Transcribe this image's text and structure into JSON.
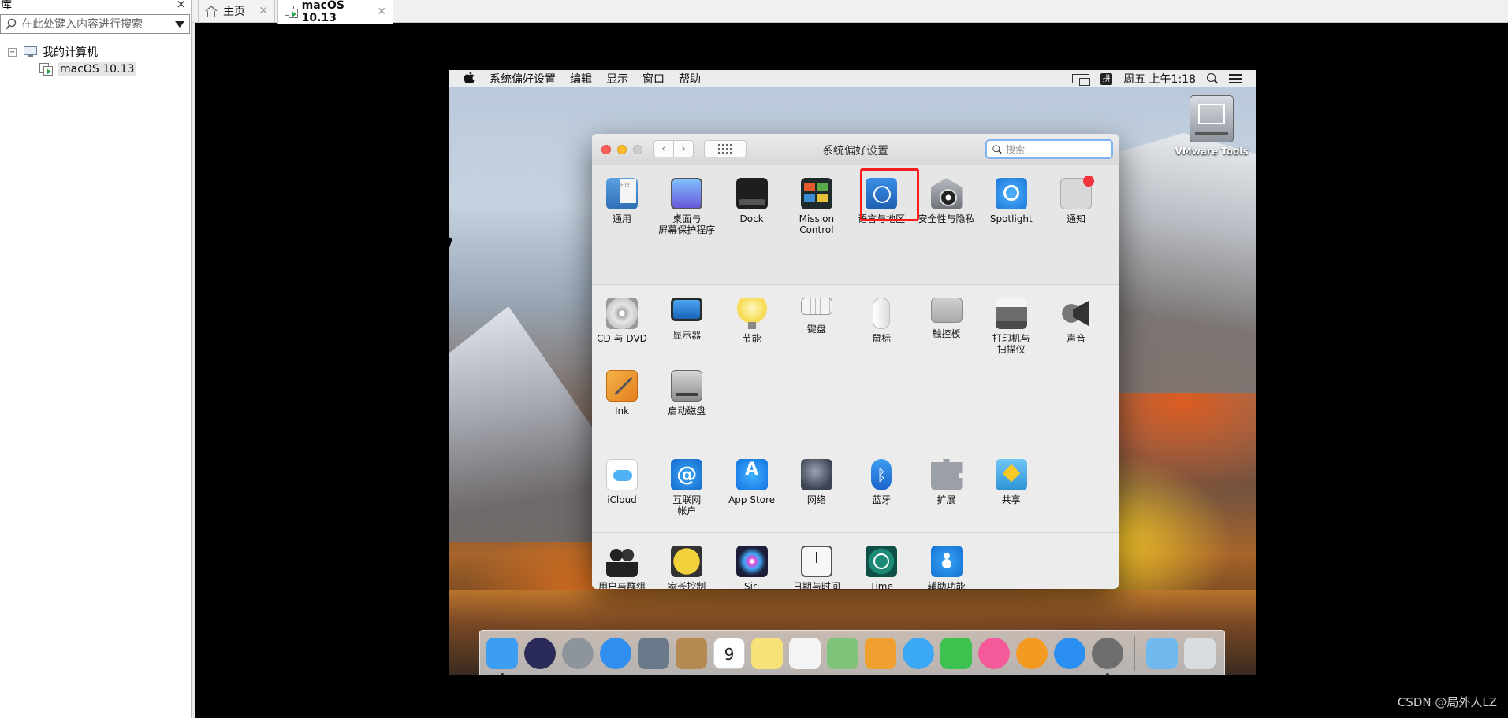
{
  "library": {
    "title": "库",
    "close_label": "×",
    "search_placeholder": "在此处键入内容进行搜索",
    "tree": {
      "expander": "⊟",
      "root_label": "我的计算机",
      "child_label": "macOS 10.13"
    }
  },
  "tabs": [
    {
      "label": "主页",
      "close": "✕",
      "active": false
    },
    {
      "label": "macOS 10.13",
      "close": "✕",
      "active": true
    }
  ],
  "mac": {
    "menubar": {
      "apple": "",
      "items": [
        "系统偏好设置",
        "编辑",
        "显示",
        "窗口",
        "帮助"
      ],
      "ime": "拼",
      "clock": "周五 上午1:18"
    },
    "desktop_icon_label": "VMware Tools",
    "prefs_window": {
      "title": "系统偏好设置",
      "search_placeholder": "搜索",
      "back": "‹",
      "forward": "›",
      "section1": [
        {
          "label": "通用",
          "icon": "general-icon"
        },
        {
          "label": "桌面与\n屏幕保护程序",
          "icon": "desktop-screensaver-icon"
        },
        {
          "label": "Dock",
          "icon": "dock-icon"
        },
        {
          "label": "Mission\nControl",
          "icon": "mission-control-icon"
        },
        {
          "label": "语言与地区",
          "icon": "language-region-icon"
        },
        {
          "label": "安全性与隐私",
          "icon": "security-privacy-icon",
          "highlighted": true
        },
        {
          "label": "Spotlight",
          "icon": "spotlight-icon"
        },
        {
          "label": "通知",
          "icon": "notifications-icon"
        }
      ],
      "section2": [
        {
          "label": "CD 与 DVD",
          "icon": "cd-dvd-icon"
        },
        {
          "label": "显示器",
          "icon": "displays-icon"
        },
        {
          "label": "节能",
          "icon": "energy-saver-icon"
        },
        {
          "label": "键盘",
          "icon": "keyboard-icon"
        },
        {
          "label": "鼠标",
          "icon": "mouse-icon"
        },
        {
          "label": "触控板",
          "icon": "trackpad-icon"
        },
        {
          "label": "打印机与\n扫描仪",
          "icon": "printer-icon"
        },
        {
          "label": "声音",
          "icon": "sound-icon"
        },
        {
          "label": "Ink",
          "icon": "ink-icon"
        },
        {
          "label": "启动磁盘",
          "icon": "startup-disk-icon"
        }
      ],
      "section3": [
        {
          "label": "iCloud",
          "icon": "icloud-icon"
        },
        {
          "label": "互联网\n帐户",
          "icon": "internet-accounts-icon"
        },
        {
          "label": "App Store",
          "icon": "app-store-icon"
        },
        {
          "label": "网络",
          "icon": "network-icon"
        },
        {
          "label": "蓝牙",
          "icon": "bluetooth-icon"
        },
        {
          "label": "扩展",
          "icon": "extensions-icon"
        },
        {
          "label": "共享",
          "icon": "sharing-icon"
        }
      ],
      "section4": [
        {
          "label": "用户与群组",
          "icon": "users-groups-icon"
        },
        {
          "label": "家长控制",
          "icon": "parental-controls-icon"
        },
        {
          "label": "Siri",
          "icon": "siri-icon"
        },
        {
          "label": "日期与时间",
          "icon": "date-time-icon"
        },
        {
          "label": "Time Machine",
          "icon": "time-machine-icon"
        },
        {
          "label": "辅助功能",
          "icon": "accessibility-icon"
        }
      ]
    },
    "dock": [
      {
        "icon": "finder-icon",
        "color": "#3d9df3",
        "running": true
      },
      {
        "icon": "siri-icon",
        "color": "#2b2b5a"
      },
      {
        "icon": "launchpad-icon",
        "color": "#8e949c"
      },
      {
        "icon": "safari-icon",
        "color": "#2f8ef0"
      },
      {
        "icon": "photo-eagle-icon",
        "color": "#6b7a8a"
      },
      {
        "icon": "contacts-icon",
        "color": "#b58a52"
      },
      {
        "icon": "calendar-icon",
        "color": "#ffffff",
        "text": "9"
      },
      {
        "icon": "notes-icon",
        "color": "#f7e27a"
      },
      {
        "icon": "reminders-icon",
        "color": "#f4f4f4"
      },
      {
        "icon": "maps-icon",
        "color": "#7fc27a"
      },
      {
        "icon": "photos-icon",
        "color": "#f0a030"
      },
      {
        "icon": "messages-icon",
        "color": "#3aa8f5"
      },
      {
        "icon": "facetime-icon",
        "color": "#3cc24f"
      },
      {
        "icon": "itunes-icon",
        "color": "#f45a9a"
      },
      {
        "icon": "ibooks-icon",
        "color": "#f39a22"
      },
      {
        "icon": "app-store-icon",
        "color": "#2a8ff0"
      },
      {
        "icon": "system-preferences-icon",
        "color": "#6e6e6e",
        "running": true
      }
    ],
    "dock_right": [
      {
        "icon": "downloads-folder-icon",
        "color": "#6fb9ee"
      },
      {
        "icon": "trash-icon",
        "color": "#d9dde0"
      }
    ]
  },
  "watermark": "CSDN @局外人LZ"
}
